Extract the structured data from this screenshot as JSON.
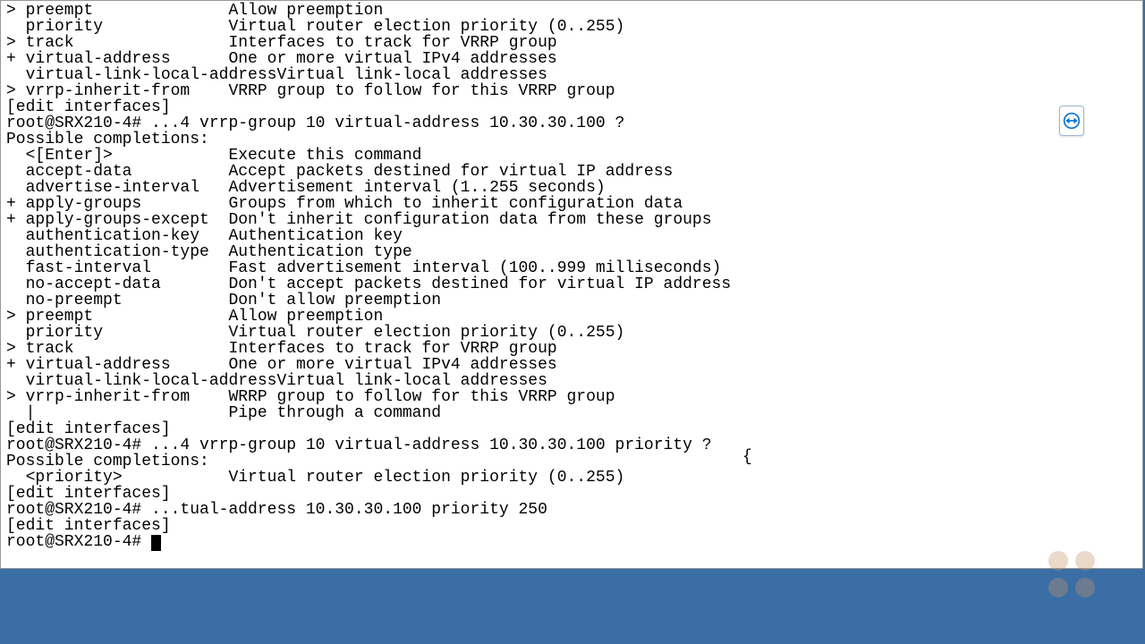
{
  "badge": {
    "name": "teamviewer"
  },
  "lines": [
    {
      "prefix": ">",
      "term": "preempt",
      "desc": "Allow preemption"
    },
    {
      "prefix": " ",
      "term": "priority",
      "desc": "Virtual router election priority (0..255)"
    },
    {
      "prefix": ">",
      "term": "track",
      "desc": "Interfaces to track for VRRP group"
    },
    {
      "prefix": "+",
      "term": "virtual-address",
      "desc": "One or more virtual IPv4 addresses"
    },
    {
      "prefix": " ",
      "term": "virtual-link-local-address",
      "desc": "Virtual link-local addresses"
    },
    {
      "prefix": ">",
      "term": "vrrp-inherit-from",
      "desc": "VRRP group to follow for this VRRP group"
    }
  ],
  "context1": "[edit interfaces]",
  "prompt1": "root@SRX210-4# ...4 vrrp-group 10 virtual-address 10.30.30.100 ?",
  "pc": "Possible completions:",
  "lines2": [
    {
      "prefix": " ",
      "term": "<[Enter]>",
      "desc": "Execute this command"
    },
    {
      "prefix": " ",
      "term": "accept-data",
      "desc": "Accept packets destined for virtual IP address"
    },
    {
      "prefix": " ",
      "term": "advertise-interval",
      "desc": "Advertisement interval (1..255 seconds)"
    },
    {
      "prefix": "+",
      "term": "apply-groups",
      "desc": "Groups from which to inherit configuration data"
    },
    {
      "prefix": "+",
      "term": "apply-groups-except",
      "desc": "Don't inherit configuration data from these groups"
    },
    {
      "prefix": " ",
      "term": "authentication-key",
      "desc": "Authentication key"
    },
    {
      "prefix": " ",
      "term": "authentication-type",
      "desc": "Authentication type"
    },
    {
      "prefix": " ",
      "term": "fast-interval",
      "desc": "Fast advertisement interval (100..999 milliseconds)"
    },
    {
      "prefix": " ",
      "term": "no-accept-data",
      "desc": "Don't accept packets destined for virtual IP address"
    },
    {
      "prefix": " ",
      "term": "no-preempt",
      "desc": "Don't allow preemption"
    },
    {
      "prefix": ">",
      "term": "preempt",
      "desc": "Allow preemption"
    },
    {
      "prefix": " ",
      "term": "priority",
      "desc": "Virtual router election priority (0..255)"
    },
    {
      "prefix": ">",
      "term": "track",
      "desc": "Interfaces to track for VRRP group"
    },
    {
      "prefix": "+",
      "term": "virtual-address",
      "desc": "One or more virtual IPv4 addresses"
    },
    {
      "prefix": " ",
      "term": "virtual-link-local-address",
      "desc": "Virtual link-local addresses"
    },
    {
      "prefix": ">",
      "term": "vrrp-inherit-from",
      "desc": "WRRP group to follow for this VRRP group"
    },
    {
      "prefix": " ",
      "term": "|",
      "desc": "Pipe through a command"
    }
  ],
  "context2": "[edit interfaces]",
  "prompt2": "root@SRX210-4# ...4 vrrp-group 10 virtual-address 10.30.30.100 priority ?",
  "lines3": [
    {
      "prefix": " ",
      "term": "<priority>",
      "desc": "Virtual router election priority (0..255)"
    }
  ],
  "context3": "[edit interfaces]",
  "prompt3": "root@SRX210-4# ...tual-address 10.30.30.100 priority 250",
  "blank": "",
  "context4": "[edit interfaces]",
  "prompt4": "root@SRX210-4# ",
  "caret_mark": "{"
}
